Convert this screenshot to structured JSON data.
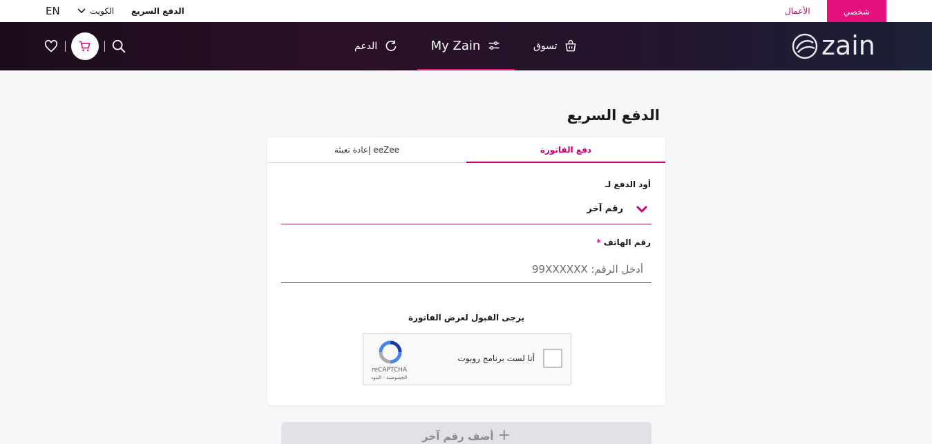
{
  "topbar": {
    "language": "EN",
    "country": "الكويت",
    "quick_pay": "الدفع السريع",
    "business": "الأعمال",
    "personal": "شخصي"
  },
  "nav": {
    "brand": "zain",
    "shop": "تسوق",
    "my_zain": "My Zain",
    "support": "الدعم",
    "icons": [
      "wishlist-heart-icon",
      "cart-icon",
      "search-icon"
    ]
  },
  "page": {
    "title": "الدفع السريع",
    "tabs": [
      {
        "label": "دفع الفاتورة",
        "active": true
      },
      {
        "label": "إعادة تعبئة eeZee",
        "active": false
      }
    ],
    "pay_for_label": "أود الدفع لـ",
    "pay_for_value": "رقم آخر",
    "phone_label": "رقم الهاتف",
    "phone_required": "*",
    "phone_placeholder": "أدخل الرقم: 99XXXXXX",
    "accept_text": "يرجى القبول لعرض الفاتورة",
    "add_number": "أضف رقم آخر"
  },
  "recaptcha": {
    "checkbox_label": "أنا لست برنامج روبوت",
    "brand": "reCAPTCHA",
    "links": "الخصوصية - البنود"
  },
  "colors": {
    "accent": "#e6117d",
    "accent_dark": "#c8006e",
    "nav_bg": "#1b0d1c",
    "page_bg": "#f7f7f9"
  }
}
